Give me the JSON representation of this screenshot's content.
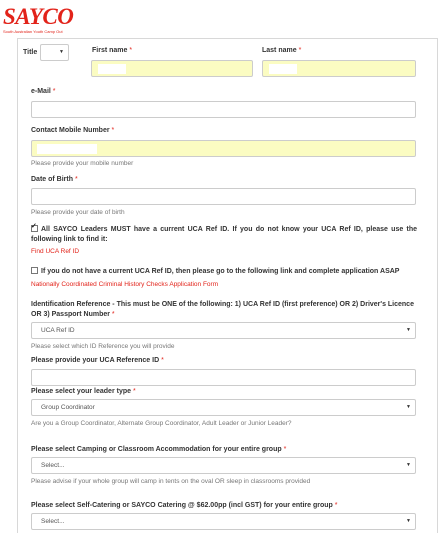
{
  "logo": {
    "main": "SAYCO",
    "sub": "South Australian Youth Camp Out"
  },
  "title": {
    "label": "Title",
    "value": ""
  },
  "first_name": {
    "label": "First name"
  },
  "last_name": {
    "label": "Last name"
  },
  "email": {
    "label": "e-Mail"
  },
  "mobile": {
    "label": "Contact Mobile Number",
    "help": "Please provide your mobile number"
  },
  "dob": {
    "label": "Date of Birth",
    "help": "Please provide your date of birth"
  },
  "uca_check": {
    "text": "All SAYCO Leaders MUST have a current UCA Ref ID. If you do not know your UCA Ref ID, please use the following link to find it:",
    "link": "Find UCA Ref ID",
    "checked": true
  },
  "no_uca_check": {
    "text": "If you do not have a current UCA Ref ID, then please go to the following link and complete application ASAP",
    "link": "Nationally Coordinated Criminal History Checks Application Form",
    "checked": false
  },
  "id_ref": {
    "label": "Identification Reference - This must be ONE of the following: 1) UCA Ref ID (first preference) OR 2) Driver's Licence OR 3) Passport Number",
    "value": "UCA Ref ID",
    "help": "Please select which ID Reference you will provide"
  },
  "uca_ref": {
    "label": "Please provide your UCA Reference ID"
  },
  "leader_type": {
    "label": "Please select your leader type",
    "value": "Group Coordinator",
    "help": "Are you a Group Coordinator, Alternate Group Coordinator, Adult Leader or Junior Leader?"
  },
  "accommodation": {
    "label": "Please select Camping or Classroom Accommodation for your entire group",
    "value": "Select...",
    "help": "Please advise if your whole group will camp in tents on the oval OR sleep in classrooms provided"
  },
  "catering": {
    "label": "Please select Self-Catering or SAYCO Catering @ $62.00pp (incl GST) for your entire group",
    "value": "Select..."
  },
  "req_mark": "*",
  "arrow": "▼"
}
